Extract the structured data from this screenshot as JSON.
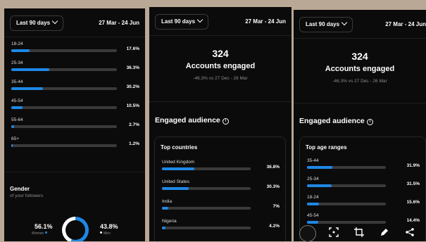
{
  "panel_left": {
    "date_filter": "Last 90 days",
    "date_range": "27 Mar - 24 Jun",
    "age_rows": [
      {
        "label": "18-24",
        "value": "17.6%",
        "pct": 17.6
      },
      {
        "label": "25-34",
        "value": "36.3%",
        "pct": 36.3
      },
      {
        "label": "35-44",
        "value": "30.2%",
        "pct": 30.2
      },
      {
        "label": "45-54",
        "value": "10.5%",
        "pct": 10.5
      },
      {
        "label": "55-64",
        "value": "2.7%",
        "pct": 2.7
      },
      {
        "label": "65+",
        "value": "1.2%",
        "pct": 1.2
      }
    ],
    "gender_title": "Gender",
    "gender_subtitle": "of your followers",
    "women_pct": "56.1%",
    "women_label": "Women",
    "men_pct": "43.8%",
    "men_label": "Men"
  },
  "panel_middle": {
    "date_filter": "Last 90 days",
    "date_range": "27 Mar - 24 Jun",
    "metric_value": "324",
    "metric_label": "Accounts engaged",
    "metric_comparison": "-46.3% vs 27 Dec - 26 Mar",
    "section_title": "Engaged audience",
    "card_title": "Top countries",
    "countries": [
      {
        "label": "United Kingdom",
        "value": "36.8%",
        "pct": 36.8
      },
      {
        "label": "United States",
        "value": "30.3%",
        "pct": 30.3
      },
      {
        "label": "India",
        "value": "7%",
        "pct": 7
      },
      {
        "label": "Nigeria",
        "value": "4.2%",
        "pct": 4.2
      }
    ]
  },
  "panel_right": {
    "date_filter": "Last 90 days",
    "date_range": "27 Mar - 24 Jun",
    "metric_value": "324",
    "metric_label": "Accounts engaged",
    "metric_comparison": "-46.3% vs 27 Dec - 26 Mar",
    "section_title": "Engaged audience",
    "card_title": "Top age ranges",
    "age_rows": [
      {
        "label": "35-44",
        "value": "31.9%",
        "pct": 31.9
      },
      {
        "label": "25-34",
        "value": "31.5%",
        "pct": 31.5
      },
      {
        "label": "18-24",
        "value": "15.6%",
        "pct": 15.6
      },
      {
        "label": "45-54",
        "value": "14.4%",
        "pct": 14.4
      }
    ]
  },
  "colors": {
    "accent": "#1e88e5",
    "track": "#3a3a3a",
    "background": "#0b0b0b"
  },
  "toolbar_icons": [
    "avatar",
    "scan-icon",
    "crop-icon",
    "pen-icon",
    "share-icon"
  ]
}
